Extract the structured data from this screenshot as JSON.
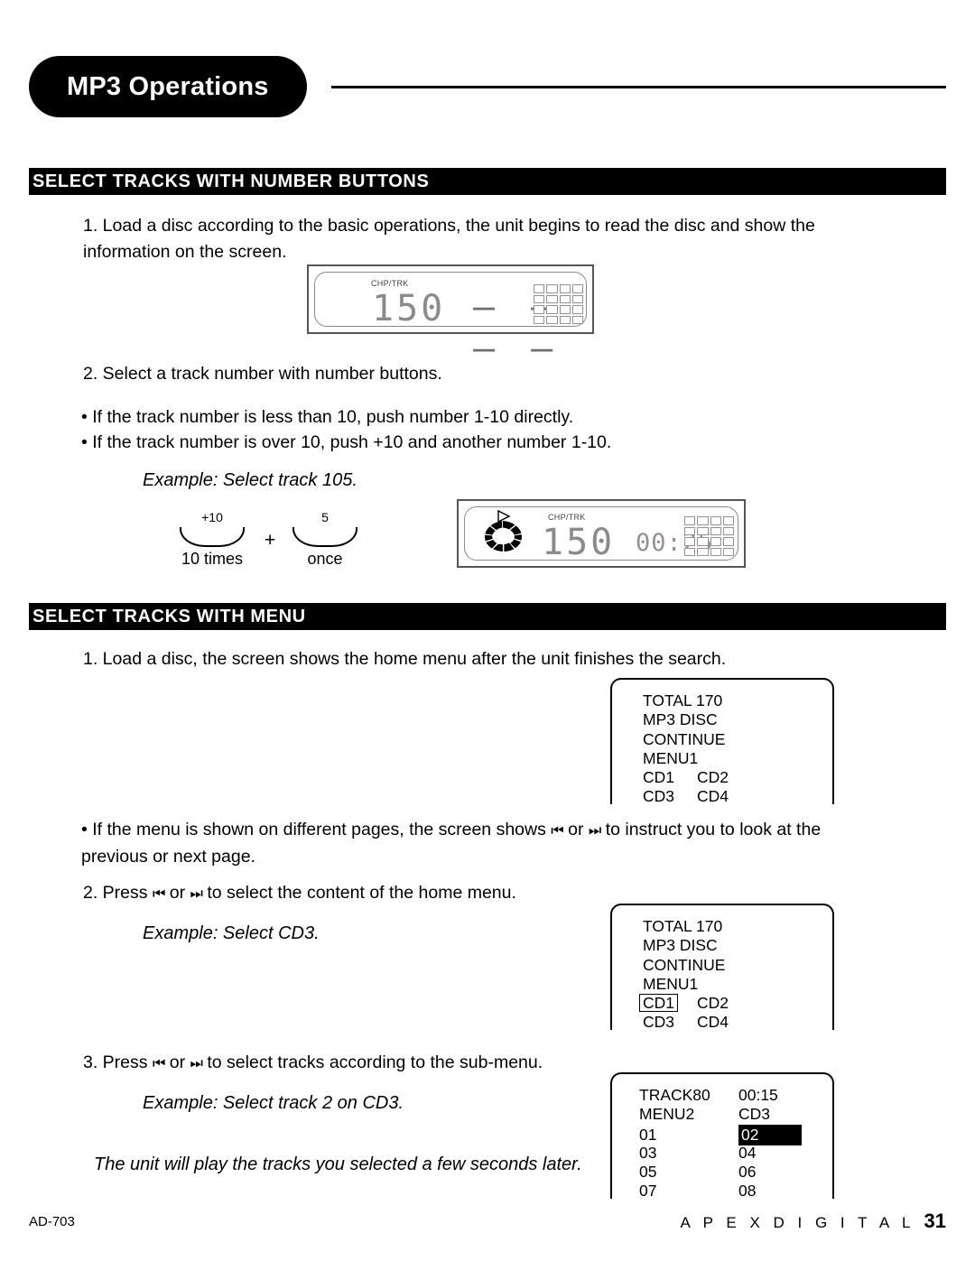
{
  "header": {
    "title": "MP3 Operations"
  },
  "sections": {
    "section1_title": "SELECT TRACKS WITH NUMBER BUTTONS",
    "section2_title": "SELECT TRACKS WITH MENU"
  },
  "body": {
    "step1": "1. Load a disc according to the basic operations, the unit begins to read the disc and show the information on the screen.",
    "step2": "2. Select a track number with number buttons.",
    "bullet1": "• If the track number is less than 10, push number 1-10 directly.",
    "bullet2": "• If the track number is over 10, push +10 and another number 1-10.",
    "example1": "Example: Select track 105.",
    "menu_step1": "1. Load a disc, the screen shows the home menu after the unit finishes the search.",
    "menu_bullet_part1": "• If the menu is shown on different pages, the screen shows",
    "menu_bullet_or": "or",
    "menu_bullet_part2": "to instruct you to look at the previous or next page.",
    "menu_step2_part1": "2. Press",
    "menu_step2_or": "or",
    "menu_step2_part2": "to select the content of the home menu.",
    "example2": "Example: Select CD3.",
    "menu_step3_part1": "3. Press",
    "menu_step3_or": "or",
    "menu_step3_part2": "to select tracks according to the sub-menu.",
    "example3": "Example: Select track 2 on CD3.",
    "closing": "The unit will play the tracks you selected a few seconds later."
  },
  "icons": {
    "skip_prev": "⏮",
    "skip_next": "⏭",
    "play_triangle": "▷"
  },
  "lcd1": {
    "label": "CHP/TRK",
    "track": "150",
    "dashes": "– –  – –"
  },
  "lcd2": {
    "label": "CHP/TRK",
    "track": "150",
    "time": "00:25"
  },
  "buttons": {
    "first_label": "+10",
    "first_caption": "10 times",
    "plus": "+",
    "second_label": "5",
    "second_caption": "once"
  },
  "screen1": {
    "line1": "TOTAL 170",
    "line2": "MP3 DISC",
    "line3": "CONTINUE",
    "line4": "MENU1",
    "line5_a": "CD1",
    "line5_b": "CD2",
    "line6_a": "CD3",
    "line6_b": "CD4"
  },
  "screen2": {
    "line1": "TOTAL 170",
    "line2": "MP3 DISC",
    "line3": "CONTINUE",
    "line4": "MENU1",
    "line5_a": "CD1",
    "line5_b": "CD2",
    "line6_a": "CD3",
    "line6_b": "CD4"
  },
  "screen3": {
    "line1_a": "TRACK80",
    "line1_b": "00:15",
    "line2_a": "MENU2",
    "line2_b": "CD3",
    "line3_a": "01",
    "line3_b": "02",
    "line4_a": "03",
    "line4_b": "04",
    "line5_a": "05",
    "line5_b": "06",
    "line6_a": "07",
    "line6_b": "08"
  },
  "footer": {
    "model": "AD-703",
    "brand": "A P E X    D I G I T A L",
    "page": "31"
  }
}
